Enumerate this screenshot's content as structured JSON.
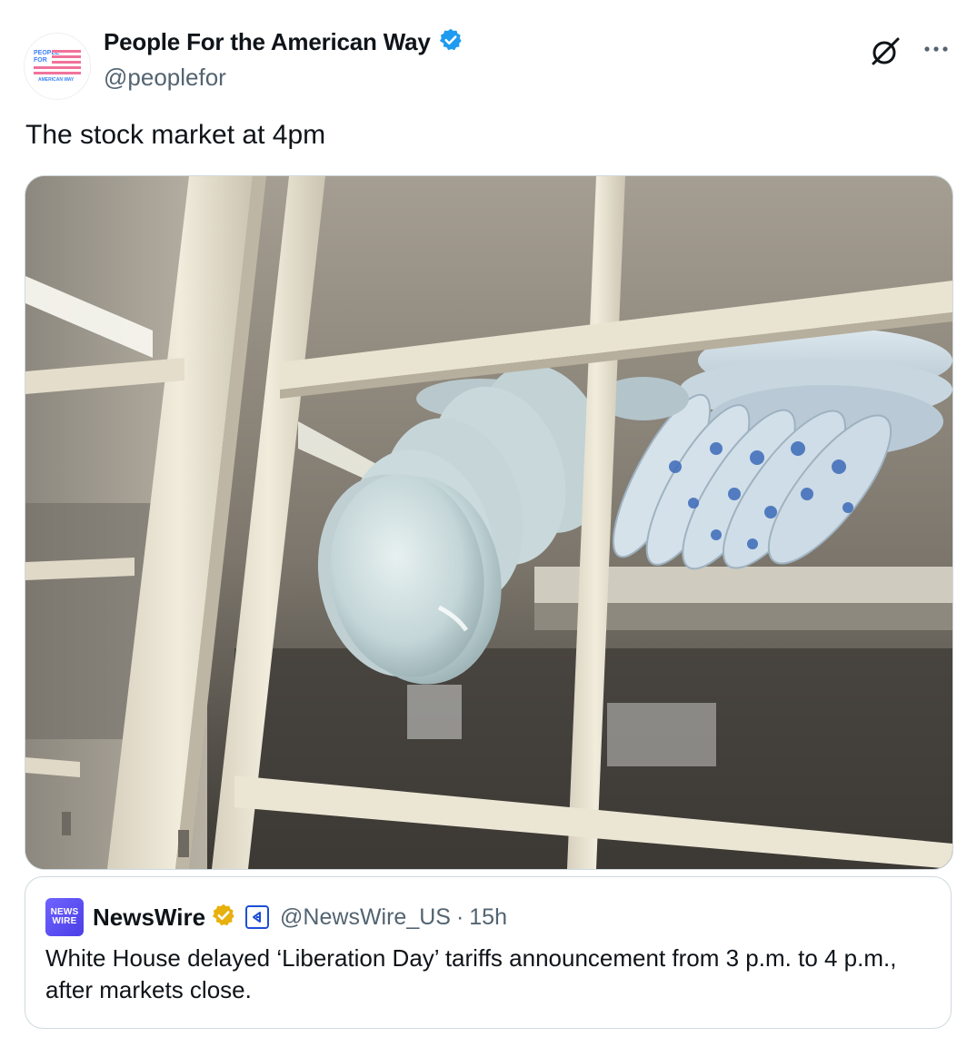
{
  "author": {
    "display_name": "People For the American Way",
    "handle": "@peoplefor",
    "avatar_text": [
      "PEOPLE",
      "FOR",
      "THE",
      "AMERICAN WAY"
    ],
    "verified_color": "#1d9bf0"
  },
  "tweet": {
    "text": "The stock market at 4pm"
  },
  "actions": {
    "grok_icon": "grok-icon",
    "more_icon": "more-icon"
  },
  "quote": {
    "logo_line1": "NEWS",
    "logo_line2": "WIRE",
    "name": "NewsWire",
    "handle": "@NewsWire_US",
    "separator": "·",
    "time": "15h",
    "text": "White House delayed ‘Liberation Day’ tariffs announcement from 3 p.m. to 4 p.m., after markets close.",
    "gold_check_color": "#e8b00d",
    "affiliate_color": "#1d4ed8"
  }
}
